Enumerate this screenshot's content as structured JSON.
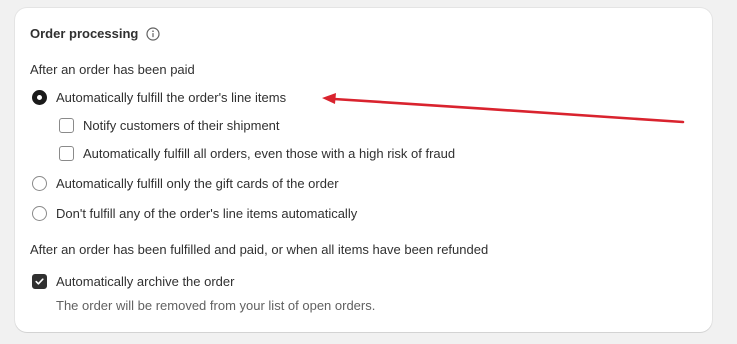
{
  "section": {
    "title": "Order processing",
    "info_icon": "info-icon"
  },
  "after_paid": {
    "label": "After an order has been paid",
    "options": [
      {
        "label": "Automatically fulfill the order's line items",
        "selected": true
      },
      {
        "label": "Automatically fulfill only the gift cards of the order",
        "selected": false
      },
      {
        "label": "Don't fulfill any of the order's line items automatically",
        "selected": false
      }
    ],
    "sub_options": [
      {
        "label": "Notify customers of their shipment",
        "checked": false
      },
      {
        "label": "Automatically fulfill all orders, even those with a high risk of fraud",
        "checked": false
      }
    ]
  },
  "after_fulfilled": {
    "label": "After an order has been fulfilled and paid, or when all items have been refunded",
    "archive": {
      "label": "Automatically archive the order",
      "checked": true,
      "help": "The order will be removed from your list of open orders."
    }
  },
  "annotation": {
    "arrow_color": "#d9232e"
  }
}
